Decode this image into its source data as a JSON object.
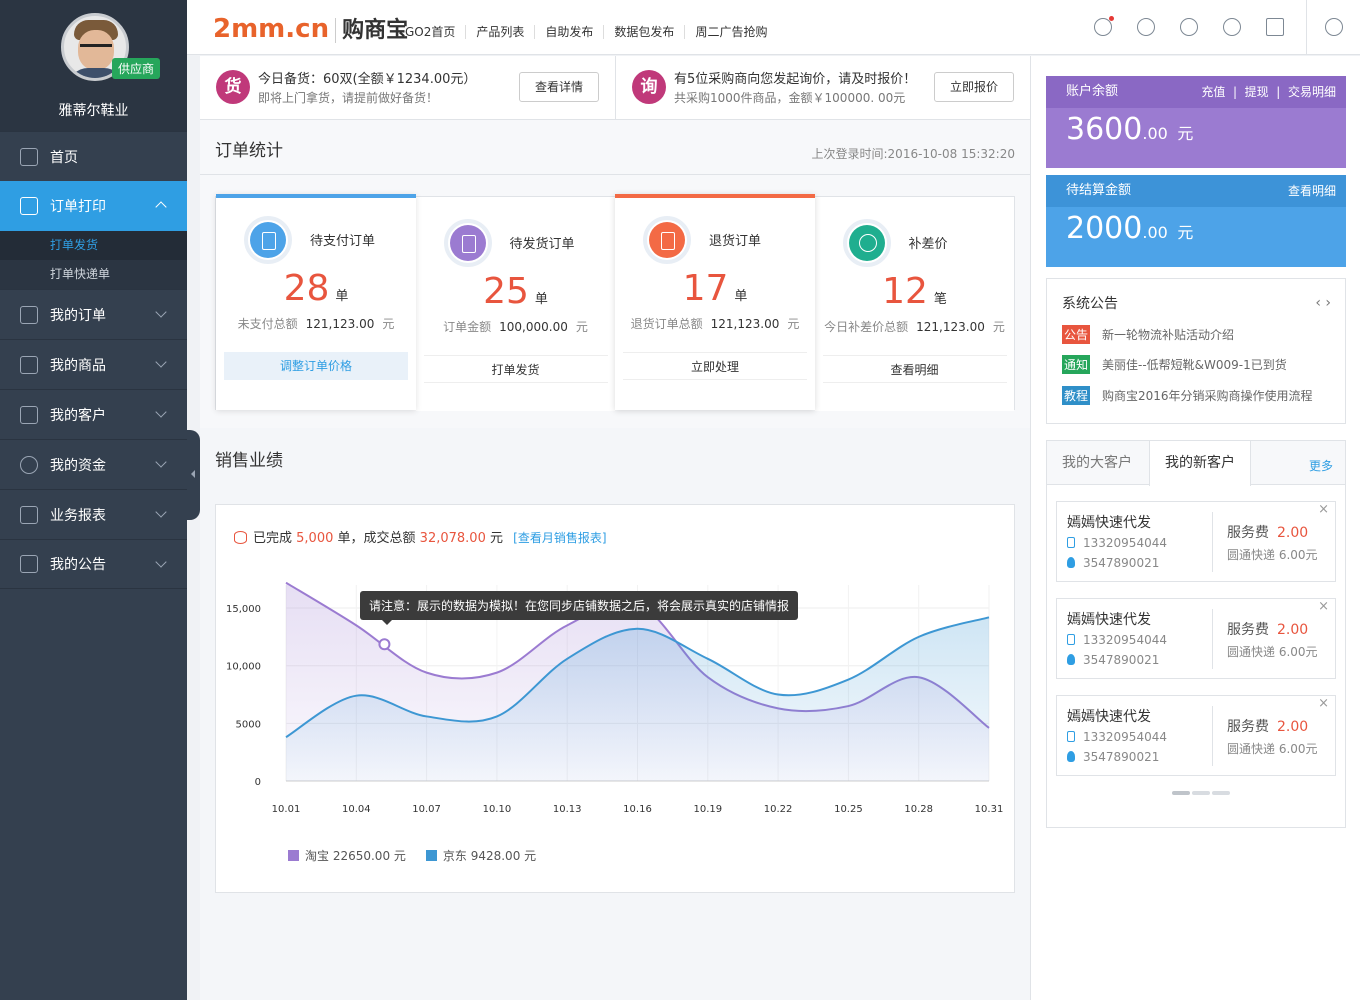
{
  "sidebar": {
    "user_name": "雅蒂尔鞋业",
    "role_badge": "供应商",
    "items": [
      {
        "label": "首页"
      },
      {
        "label": "订单打印"
      },
      {
        "label": "我的订单"
      },
      {
        "label": "我的商品"
      },
      {
        "label": "我的客户"
      },
      {
        "label": "我的资金"
      },
      {
        "label": "业务报表"
      },
      {
        "label": "我的公告"
      }
    ],
    "sub_items": [
      "打单发货",
      "打单快递单"
    ]
  },
  "topbar": {
    "logo_en": "2mm.cn",
    "logo_cn": "购商宝",
    "nav": [
      "GO2首页",
      "产品列表",
      "自助发布",
      "数据包发布",
      "周二广告抢购"
    ],
    "icons": [
      "chat-icon",
      "user-icon",
      "gear-icon",
      "service-icon",
      "qrcode-icon",
      "power-icon"
    ]
  },
  "notices": [
    {
      "badge": "货",
      "title": "今日备货：60双(全额￥1234.00元）",
      "desc": "即将上门拿货，请提前做好备货！",
      "button": "查看详情"
    },
    {
      "badge": "询",
      "title": "有5位采购商向您发起询价，请及时报价！",
      "desc": "共采购1000件商品，金额￥100000. 00元",
      "button": "立即报价"
    }
  ],
  "order_stats": {
    "title": "订单统计",
    "last_login": "上次登录时间:2016-10-08 15:32:20",
    "cards": [
      {
        "label": "待支付订单",
        "count": "28",
        "unit": "单",
        "sum_label": "未支付总额",
        "sum": "121,123.00",
        "currency": "元",
        "action": "调整订单价格",
        "color": "#4da3e8"
      },
      {
        "label": "待发货订单",
        "count": "25",
        "unit": "单",
        "sum_label": "订单金额",
        "sum": "100,000.00",
        "currency": "元",
        "action": "打单发货",
        "color": "#9b7bd1"
      },
      {
        "label": "退货订单",
        "count": "17",
        "unit": "单",
        "sum_label": "退货订单总额",
        "sum": "121,123.00",
        "currency": "元",
        "action": "立即处理",
        "color": "#f36a45"
      },
      {
        "label": "补差价",
        "count": "12",
        "unit": "笔",
        "sum_label": "今日补差价总额",
        "sum": "121,123.00",
        "currency": "元",
        "action": "查看明细",
        "color": "#1fae8f"
      }
    ]
  },
  "sales": {
    "title": "销售业绩",
    "summary_prefix": "已完成",
    "orders": "5,000",
    "summary_mid": "单，成交总额",
    "amount": "32,078.00",
    "summary_suffix": "元",
    "report_link": "[查看月销售报表]",
    "tooltip": "请注意：展示的数据为模拟！在您同步店铺数据之后，将会展示真实的店铺情报"
  },
  "chart_data": {
    "type": "area",
    "x": [
      "10.01",
      "10.04",
      "10.07",
      "10.10",
      "10.13",
      "10.16",
      "10.19",
      "10.22",
      "10.25",
      "10.28",
      "10.31"
    ],
    "ylim": [
      0,
      17000
    ],
    "yticks": [
      "0",
      "5000",
      "10,000",
      "15,000"
    ],
    "series": [
      {
        "name": "淘宝 22650.00 元",
        "color": "#9b7bd1",
        "values": [
          17200,
          13500,
          9400,
          9400,
          13500,
          15400,
          9000,
          6300,
          6500,
          9000,
          4600
        ]
      },
      {
        "name": "京东 9428.00 元",
        "color": "#3d97d3",
        "values": [
          3800,
          7400,
          5600,
          5600,
          10600,
          13200,
          10600,
          7500,
          8800,
          12500,
          14200
        ]
      }
    ]
  },
  "account": {
    "balance_title": "账户余额",
    "balance_links": [
      "充值",
      "提现",
      "交易明细"
    ],
    "balance_int": "3600",
    "balance_dec": ".00",
    "balance_unit": "元",
    "pending_title": "待结算金额",
    "pending_link": "查看明细",
    "pending_int": "2000",
    "pending_dec": ".00",
    "pending_unit": "元"
  },
  "announcements": {
    "title": "系统公告",
    "items": [
      {
        "tag": "公告",
        "text": "新一轮物流补贴活动介绍",
        "color": "#e8553e"
      },
      {
        "tag": "通知",
        "text": "美丽佳--低帮短靴&W009-1已到货",
        "color": "#26a65b"
      },
      {
        "tag": "教程",
        "text": "购商宝2016年分销采购商操作使用流程",
        "color": "#2f8fc8"
      }
    ]
  },
  "customers": {
    "tabs": [
      "我的大客户",
      "我的新客户"
    ],
    "more": "更多",
    "cards": [
      {
        "name": "嫣嫣快速代发",
        "phone": "13320954044",
        "qq": "3547890021",
        "fee_label": "服务费",
        "fee": "2.00",
        "express": "圆通快递  6.00元"
      },
      {
        "name": "嫣嫣快速代发",
        "phone": "13320954044",
        "qq": "3547890021",
        "fee_label": "服务费",
        "fee": "2.00",
        "express": "圆通快递  6.00元"
      },
      {
        "name": "嫣嫣快速代发",
        "phone": "13320954044",
        "qq": "3547890021",
        "fee_label": "服务费",
        "fee": "2.00",
        "express": "圆通快递  6.00元"
      }
    ]
  }
}
